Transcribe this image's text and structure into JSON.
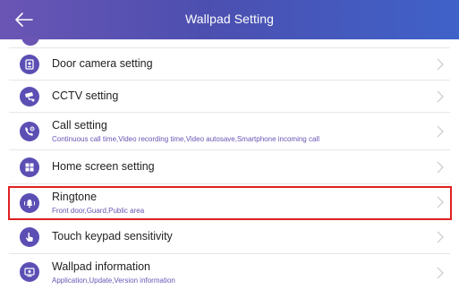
{
  "header": {
    "title": "Wallpad Setting",
    "back_icon": "arrow-left-icon",
    "gradient": [
      "#6a55b4",
      "#4c4fb0",
      "#3f62c9"
    ]
  },
  "colors": {
    "icon_bg": "#5b4fb4",
    "subtitle": "#6a55b4",
    "highlight_border": "#e02020",
    "chevron": "#c8c8c8"
  },
  "menu": {
    "items": [
      {
        "title": "Door camera setting",
        "subtitle": "",
        "icon": "door-camera-icon"
      },
      {
        "title": "CCTV setting",
        "subtitle": "",
        "icon": "cctv-icon"
      },
      {
        "title": "Call setting",
        "subtitle": "Continuous call time,Video recording time,Video autosave,Smartphone incoming call",
        "icon": "phone-settings-icon"
      },
      {
        "title": "Home screen setting",
        "subtitle": "",
        "icon": "home-screen-icon"
      },
      {
        "title": "Ringtone",
        "subtitle": "Front door,Guard,Public area",
        "icon": "ringtone-icon",
        "highlighted": true
      },
      {
        "title": "Touch keypad sensitivity",
        "subtitle": "",
        "icon": "touch-icon"
      },
      {
        "title": "Wallpad information",
        "subtitle": "Application,Update,Version information",
        "icon": "info-monitor-icon"
      }
    ]
  }
}
